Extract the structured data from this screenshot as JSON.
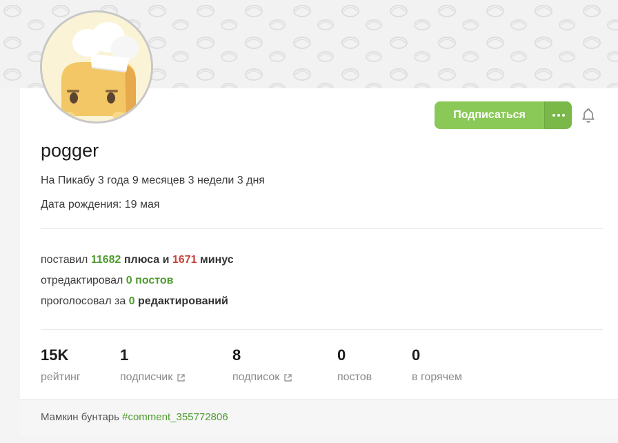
{
  "profile": {
    "username": "pogger",
    "on_site": "На Пикабу 3 года 9 месяцев 3 недели 3 дня",
    "birthday": "Дата рождения: 19 мая"
  },
  "actions": {
    "subscribe_label": "Подписаться",
    "more_label": "···"
  },
  "activity": {
    "line1": {
      "prefix": "поставил ",
      "plus_count": "11682",
      "mid": " плюса и ",
      "minus_count": "1671",
      "suffix": " минус"
    },
    "line2": {
      "prefix": "отредактировал ",
      "count": "0",
      "suffix": " постов"
    },
    "line3": {
      "prefix": "проголосовал за ",
      "count": "0",
      "suffix": " редактирований"
    }
  },
  "stats": [
    {
      "value": "15K",
      "label": "рейтинг"
    },
    {
      "value": "1",
      "label": "подписчик"
    },
    {
      "value": "8",
      "label": "подписок"
    },
    {
      "value": "0",
      "label": "постов"
    },
    {
      "value": "0",
      "label": "в горячем"
    }
  ],
  "footer": {
    "text": "Мамкин бунтарь ",
    "link": "#comment_355772806"
  },
  "colors": {
    "accent_green": "#8ac858",
    "plus_green": "#4f9a2f",
    "minus_red": "#c8423a"
  },
  "icons": {
    "bell": "bell-icon",
    "more": "more-dots-icon",
    "external": "external-link-icon"
  }
}
